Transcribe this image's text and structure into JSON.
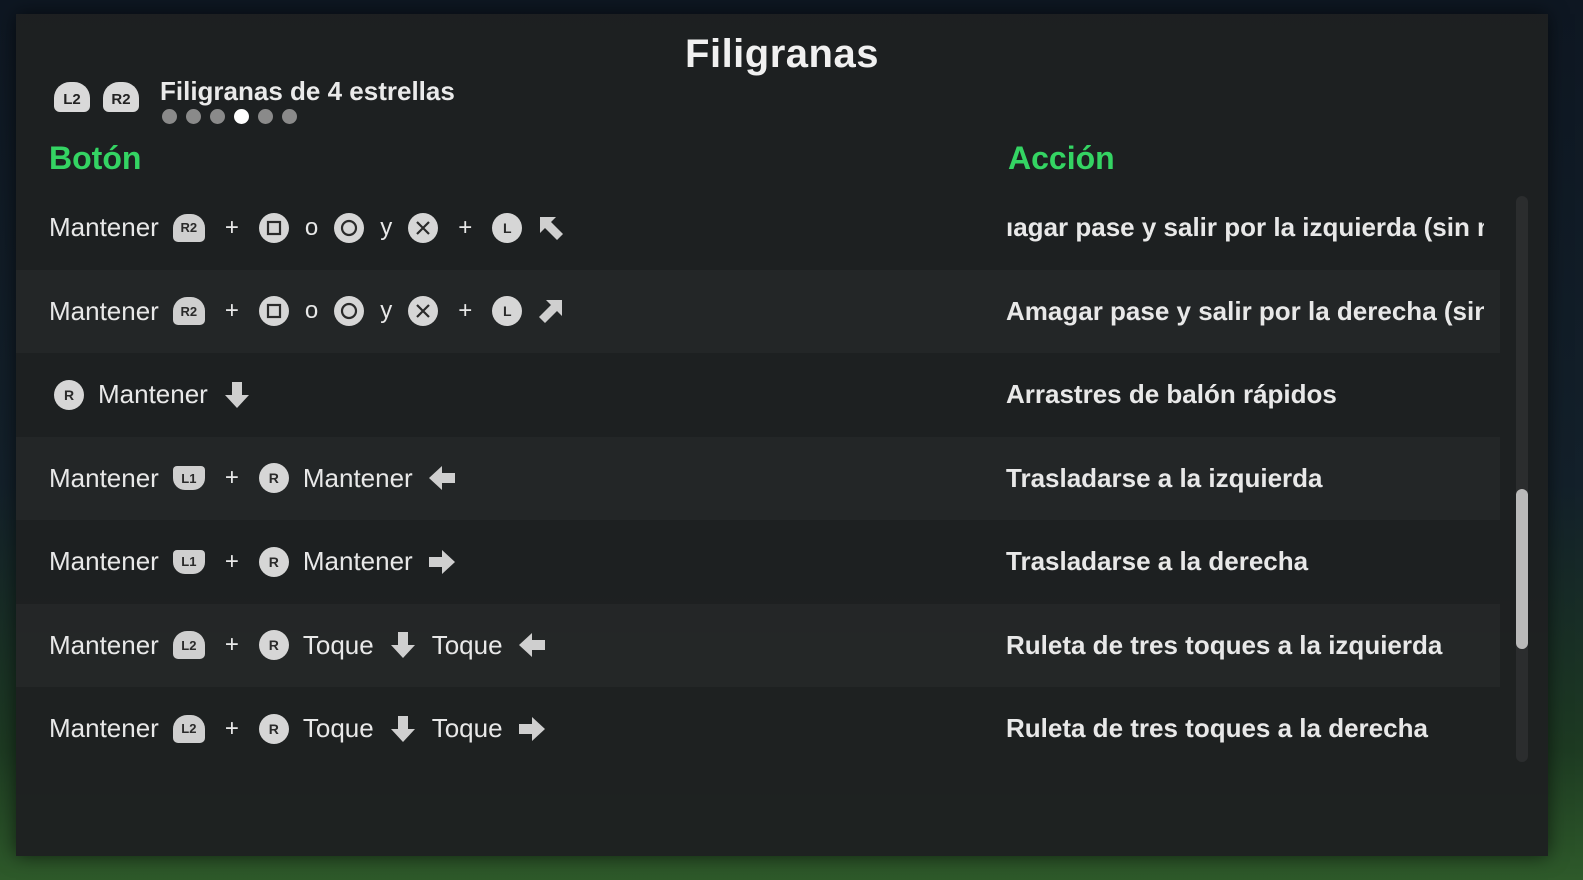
{
  "title": "Filigranas",
  "category": {
    "triggers": [
      "L2",
      "R2"
    ],
    "label": "Filigranas de 4 estrellas",
    "dots_total": 6,
    "active_dot": 4
  },
  "headers": {
    "button": "Botón",
    "action": "Acción"
  },
  "words": {
    "hold": "Mantener",
    "tap": "Toque",
    "or": "o",
    "and": "y",
    "plus": "+"
  },
  "buttons": {
    "r2": "R2",
    "l2": "L2",
    "l1": "L1",
    "l_stick": "L",
    "r_stick": "R"
  },
  "icons": [
    "square-icon",
    "circle-icon",
    "cross-icon",
    "arrow-up-left-icon",
    "arrow-up-right-icon",
    "arrow-down-icon",
    "arrow-left-icon",
    "arrow-right-icon"
  ],
  "actions": [
    "ıagar pase y salir por la izquierda (sin movers",
    "Amagar pase y salir por la derecha (sin move",
    "Arrastres de balón rápidos",
    "Trasladarse a la izquierda",
    "Trasladarse a la derecha",
    "Ruleta de tres toques a la izquierda",
    "Ruleta de tres toques a la derecha"
  ],
  "colors": {
    "accent": "#34d463",
    "panel": "#1e2021",
    "text": "#e8e8e8"
  }
}
